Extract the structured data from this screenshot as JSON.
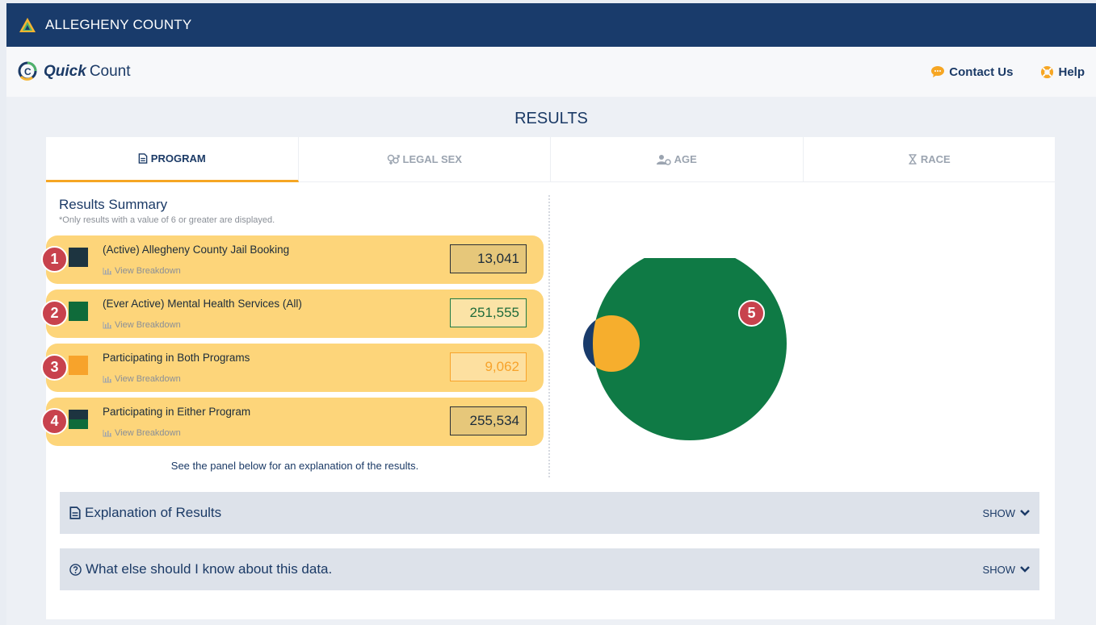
{
  "header": {
    "org_name": "ALLEGHENY COUNTY"
  },
  "app": {
    "name_bold": "Quick",
    "name_rest": "Count",
    "contact_label": "Contact Us",
    "help_label": "Help"
  },
  "page": {
    "title": "RESULTS"
  },
  "tabs": [
    {
      "label": "PROGRAM",
      "icon": "document-icon",
      "active": true
    },
    {
      "label": "LEGAL SEX",
      "icon": "gender-icon",
      "active": false
    },
    {
      "label": "AGE",
      "icon": "people-icon",
      "active": false
    },
    {
      "label": "RACE",
      "icon": "hourglass-icon",
      "active": false
    }
  ],
  "summary": {
    "title": "Results Summary",
    "note": "*Only results with a value of 6 or greater are displayed.",
    "rows": [
      {
        "badge": "1",
        "label": "(Active) Allegheny County Jail Booking",
        "link": "View Breakdown",
        "value": "13,041",
        "color": "#1d3440"
      },
      {
        "badge": "2",
        "label": "(Ever Active) Mental Health Services (All)",
        "link": "View Breakdown",
        "value": "251,555",
        "color": "#0f6b3a"
      },
      {
        "badge": "3",
        "label": "Participating in Both Programs",
        "link": "View Breakdown",
        "value": "9,062",
        "color": "#f7a32b"
      },
      {
        "badge": "4",
        "label": "Participating in Either Program",
        "link": "View Breakdown",
        "value": "255,534",
        "color": "#0f6b3a"
      }
    ],
    "footer": "See the panel below for an explanation of the results."
  },
  "venn": {
    "badge": "5",
    "left_color": "#193b6b",
    "right_color": "#0f7a45",
    "overlap_color": "#f6ae2d"
  },
  "accordions": [
    {
      "title": "Explanation of Results",
      "toggle": "SHOW"
    },
    {
      "title": "What else should I know about this data.",
      "toggle": "SHOW"
    }
  ]
}
